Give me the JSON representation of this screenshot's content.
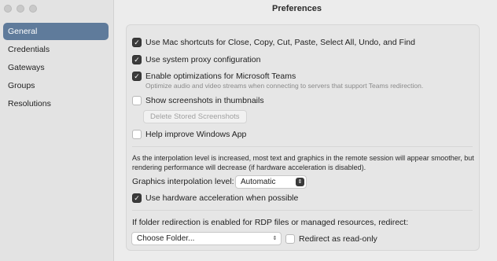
{
  "window": {
    "title": "Preferences"
  },
  "sidebar": {
    "items": [
      {
        "label": "General",
        "active": true
      },
      {
        "label": "Credentials",
        "active": false
      },
      {
        "label": "Gateways",
        "active": false
      },
      {
        "label": "Groups",
        "active": false
      },
      {
        "label": "Resolutions",
        "active": false
      }
    ]
  },
  "general": {
    "mac_shortcuts": {
      "label": "Use Mac shortcuts for Close, Copy, Cut, Paste, Select All, Undo, and Find",
      "checked": true
    },
    "system_proxy": {
      "label": "Use system proxy configuration",
      "checked": true
    },
    "teams_optimizations": {
      "label": "Enable optimizations for Microsoft Teams",
      "checked": true,
      "description": "Optimize audio and video streams when connecting to servers that support Teams redirection."
    },
    "screenshots_thumbnails": {
      "label": "Show screenshots in thumbnails",
      "checked": false
    },
    "delete_screenshots_button": "Delete Stored Screenshots",
    "help_improve": {
      "label": "Help improve Windows App",
      "checked": false
    },
    "interpolation_note": "As the interpolation level is increased, most text and graphics in the remote session will appear smoother, but rendering performance will decrease (if hardware acceleration is disabled).",
    "interpolation": {
      "label": "Graphics interpolation level:",
      "value": "Automatic"
    },
    "hardware_acceleration": {
      "label": "Use hardware acceleration when possible",
      "checked": true
    },
    "folder_redirect_label": "If folder redirection is enabled for RDP files or managed resources, redirect:",
    "folder_select": {
      "value": "Choose Folder..."
    },
    "read_only": {
      "label": "Redirect as read-only",
      "checked": false
    }
  },
  "icons": {
    "check": "checkmark-icon",
    "updown": "up-down-chevron-icon",
    "down": "chevron-down-icon"
  }
}
